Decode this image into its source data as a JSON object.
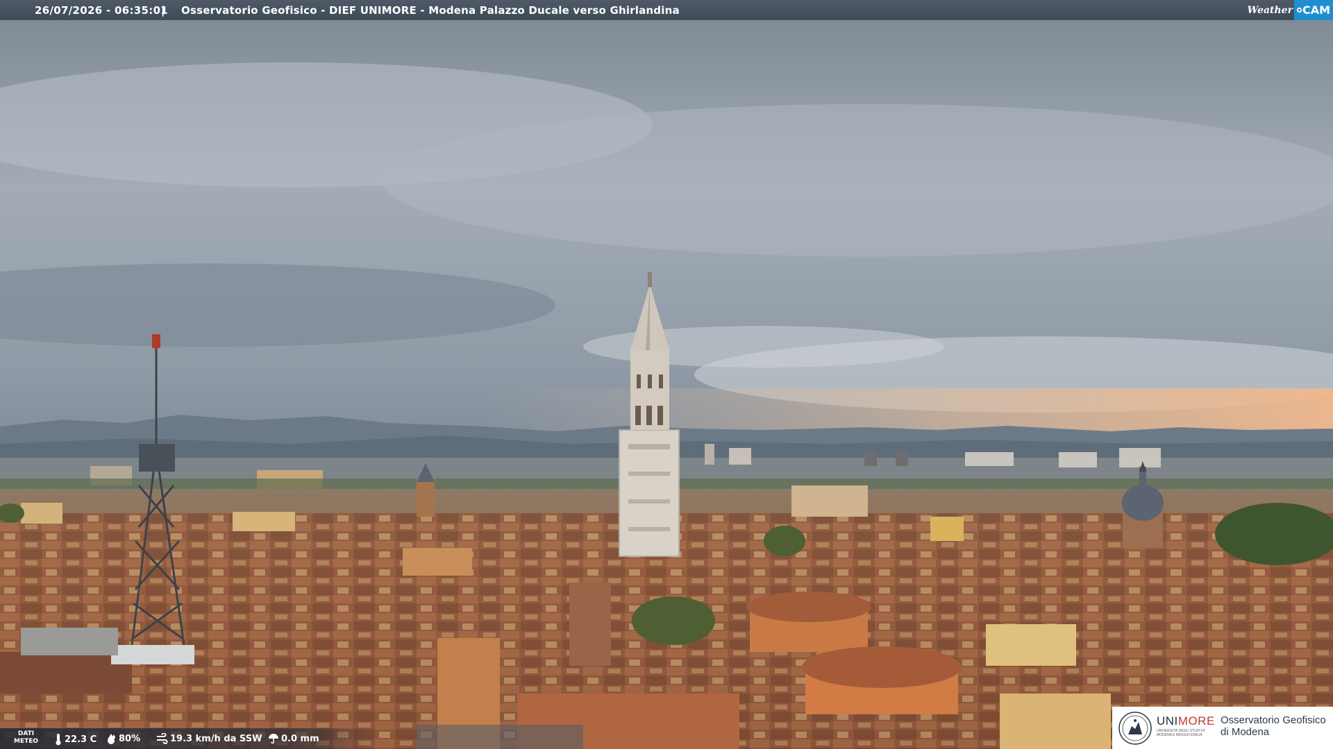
{
  "header": {
    "timestamp": "26/07/2026 - 06:35:01",
    "separator": "|",
    "title": "Osservatorio Geofisico - DIEF UNIMORE - Modena Palazzo Ducale verso Ghirlandina"
  },
  "brand": {
    "weather": "Weather",
    "cam": "CAM",
    "accent": "#1f8ed0"
  },
  "meteo": {
    "label_line1": "DATI",
    "label_line2": "METEO",
    "temperature": "22.3 C",
    "humidity": "80%",
    "wind": "19.3 km/h da SSW",
    "rain": "0.0 mm"
  },
  "logo": {
    "name_uni": "UNI",
    "name_more": "MORE",
    "subtitle": "UNIVERSITÀ DEGLI STUDI DI MODENA E REGGIO EMILIA",
    "obs_line1": "Osservatorio Geofisico",
    "obs_line2": "di Modena",
    "brand_red": "#c0392b"
  },
  "icons": {
    "temperature": "thermometer-icon",
    "humidity": "drop-icon",
    "wind": "wind-icon",
    "rain": "umbrella-icon",
    "cam": "camera-dot-icon"
  }
}
